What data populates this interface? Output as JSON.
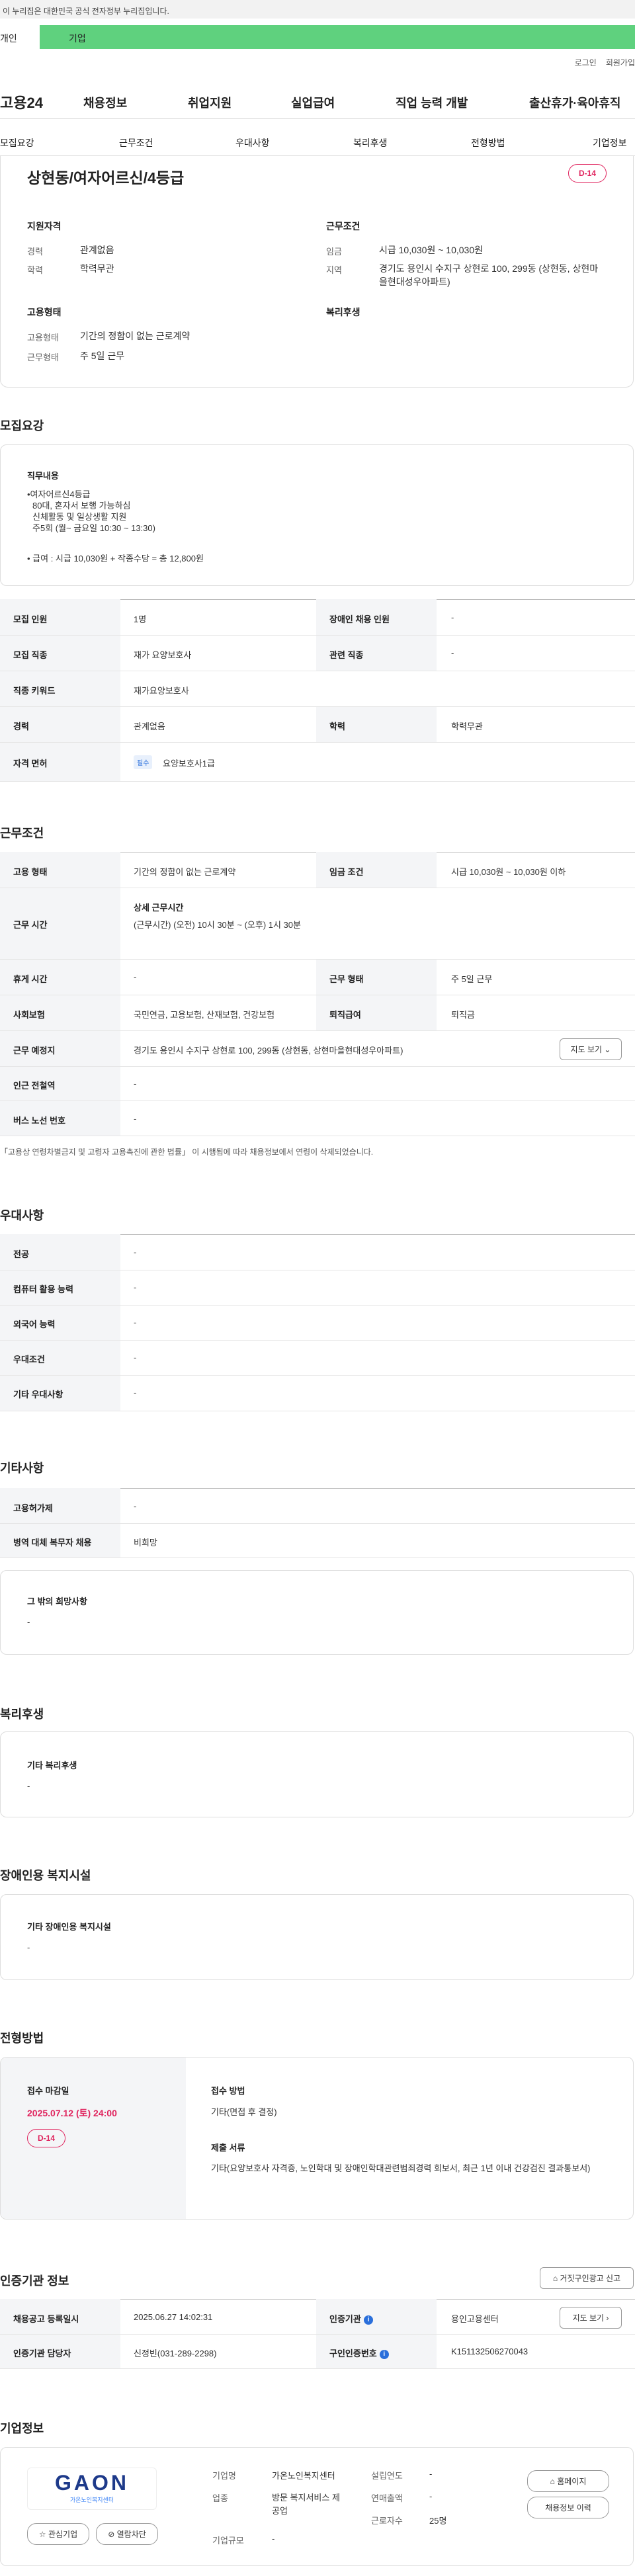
{
  "gov_bar": "이 누리집은 대한민국 공식 전자정부 누리집입니다.",
  "tabs": [
    "개인",
    "기업"
  ],
  "util": [
    "로그인",
    "회원가입"
  ],
  "logo": "고용24",
  "gnb": [
    "채용정보",
    "취업지원",
    "실업급여",
    "직업 능력 개발",
    "출산휴가·육아휴직"
  ],
  "snb": [
    "모집요강",
    "근무조건",
    "우대사항",
    "복리후생",
    "전형방법",
    "기업정보"
  ],
  "job_title": "상현동/여자어르신/4등급",
  "dday": "D-14",
  "summary": {
    "qual_head": "지원자격",
    "cond_head": "근무조건",
    "emp_head": "고용형태",
    "welf_head": "복리후생",
    "career_label": "경력",
    "career": "관계없음",
    "edu_label": "학력",
    "edu": "학력무관",
    "wage_label": "임금",
    "wage": "시급 10,030원 ~ 10,030원",
    "region_label": "지역",
    "region": "경기도 용인시 수지구 상현로 100, 299동 (상현동, 상현마을현대성우아파트)",
    "emptype_label": "고용형태",
    "emptype": "기간의 정함이 없는 근로계약",
    "worktype_label": "근무형태",
    "worktype": "주 5일 근무"
  },
  "recruit": {
    "title": "모집요강",
    "duty_head": "직무내용",
    "duty_lines": [
      "•여자어르신4등급",
      "80대, 혼자서 보행 가능하심",
      "신체활동 및 일상생활 지원",
      "주5회 (월~ 금요일 10:30 ~ 13:30)"
    ],
    "pay_line": "• 급여 : 시급 10,030원 + 작종수당 = 총 12,800원",
    "rows": [
      {
        "l1": "모집 인원",
        "v1": "1명",
        "l2": "장애인 채용 인원",
        "v2": "-"
      },
      {
        "l1": "모집 직종",
        "v1": "재가 요양보호사",
        "l2": "관련 직종",
        "v2": "-"
      },
      {
        "l1": "직종 키워드",
        "v1": "재가요양보호사"
      },
      {
        "l1": "경력",
        "v1": "관계없음",
        "l2": "학력",
        "v2": "학력무관"
      },
      {
        "l1": "자격 면허",
        "tag": "필수",
        "v1": "요양보호사1급"
      }
    ]
  },
  "work": {
    "title": "근무조건",
    "r1": {
      "l1": "고용 형태",
      "v1": "기간의 정함이 없는 근로계약",
      "l2": "임금 조건",
      "v2": "시급 10,030원 ~ 10,030원 이하"
    },
    "r2": {
      "l1": "근무 시간",
      "head": "상세 근무시간",
      "v": "(근무시간) (오전) 10시 30분 ~ (오후) 1시 30분"
    },
    "r3": {
      "l1": "휴게 시간",
      "v1": "-",
      "l2": "근무 형태",
      "v2": "주 5일 근무"
    },
    "r4": {
      "l1": "사회보험",
      "v1": "국민연금, 고용보험, 산재보험, 건강보험",
      "l2": "퇴직급여",
      "v2": "퇴직금"
    },
    "r5": {
      "l1": "근무 예정지",
      "v1": "경기도 용인시 수지구 상현로 100, 299동 (상현동, 상현마을현대성우아파트)",
      "btn": "지도 보기"
    },
    "r6": {
      "l1": "인근 전철역",
      "v1": "-"
    },
    "r7": {
      "l1": "버스 노선 번호",
      "v1": "-"
    },
    "note": "「고용상 연령차별금지 및 고령자 고용촉진에 관한 법률」 이 시행됨에 따라 채용정보에서 연령이 삭제되었습니다."
  },
  "pref": {
    "title": "우대사항",
    "rows": [
      {
        "l": "전공",
        "v": "-"
      },
      {
        "l": "컴퓨터 활용 능력",
        "v": "-"
      },
      {
        "l": "외국어 능력",
        "v": "-"
      },
      {
        "l": "우대조건",
        "v": "-"
      },
      {
        "l": "기타 우대사항",
        "v": "-"
      }
    ]
  },
  "etc": {
    "title": "기타사항",
    "rows": [
      {
        "l": "고용허가제",
        "v": "-"
      },
      {
        "l": "병역 대체 복무자 채용",
        "v": "비희망"
      }
    ],
    "card_head": "그 밖의 희망사항",
    "card_val": "-"
  },
  "welfare": {
    "title": "복리후생",
    "card_head": "기타 복리후생",
    "card_val": "-"
  },
  "disab": {
    "title": "장애인용 복지시설",
    "card_head": "기타 장애인용 복지시설",
    "card_val": "-"
  },
  "process": {
    "title": "전형방법",
    "deadline_head": "접수 마감일",
    "deadline": "2025.07.12 (토) 24:00",
    "dday": "D-14",
    "method_head": "접수 방법",
    "method": "기타(면접 후 결정)",
    "docs_head": "제출 서류",
    "docs": "기타(요양보호사 자격증, 노인학대 및 장애인학대관련범죄경력 회보서, 최근 1년 이내 건강검진 결과통보서)"
  },
  "agency": {
    "title": "인증기관 정보",
    "report_btn": "거짓구인광고 신고",
    "l1": "채용공고 등록일시",
    "v1": "2025.06.27 14:02:31",
    "l2": "인증기관",
    "v2": "용인고용센터",
    "map_btn": "지도 보기",
    "l3": "인증기관 담당자",
    "v3": "신정빈(031-289-2298)",
    "l4": "구인인증번호",
    "v4": "K151132506270043"
  },
  "company": {
    "title": "기업정보",
    "logo_text": "GAON",
    "logo_sub": "가온노인복지센터",
    "fav_btn": "관심기업",
    "block_btn": "열람차단",
    "name_label": "기업명",
    "name": "가온노인복지센터",
    "ind_label": "업종",
    "ind": "방문 복지서비스 제공업",
    "size_label": "기업규모",
    "size": "-",
    "year_label": "설립연도",
    "year": "-",
    "sales_label": "연매출액",
    "sales": "-",
    "emp_label": "근로자수",
    "emp": "25명",
    "home_btn": "홈페이지",
    "history_btn": "채용정보 이력"
  },
  "colors": {
    "accent": "#5fd17e",
    "dday": "#e0245e",
    "info": "#2a6fdb"
  }
}
